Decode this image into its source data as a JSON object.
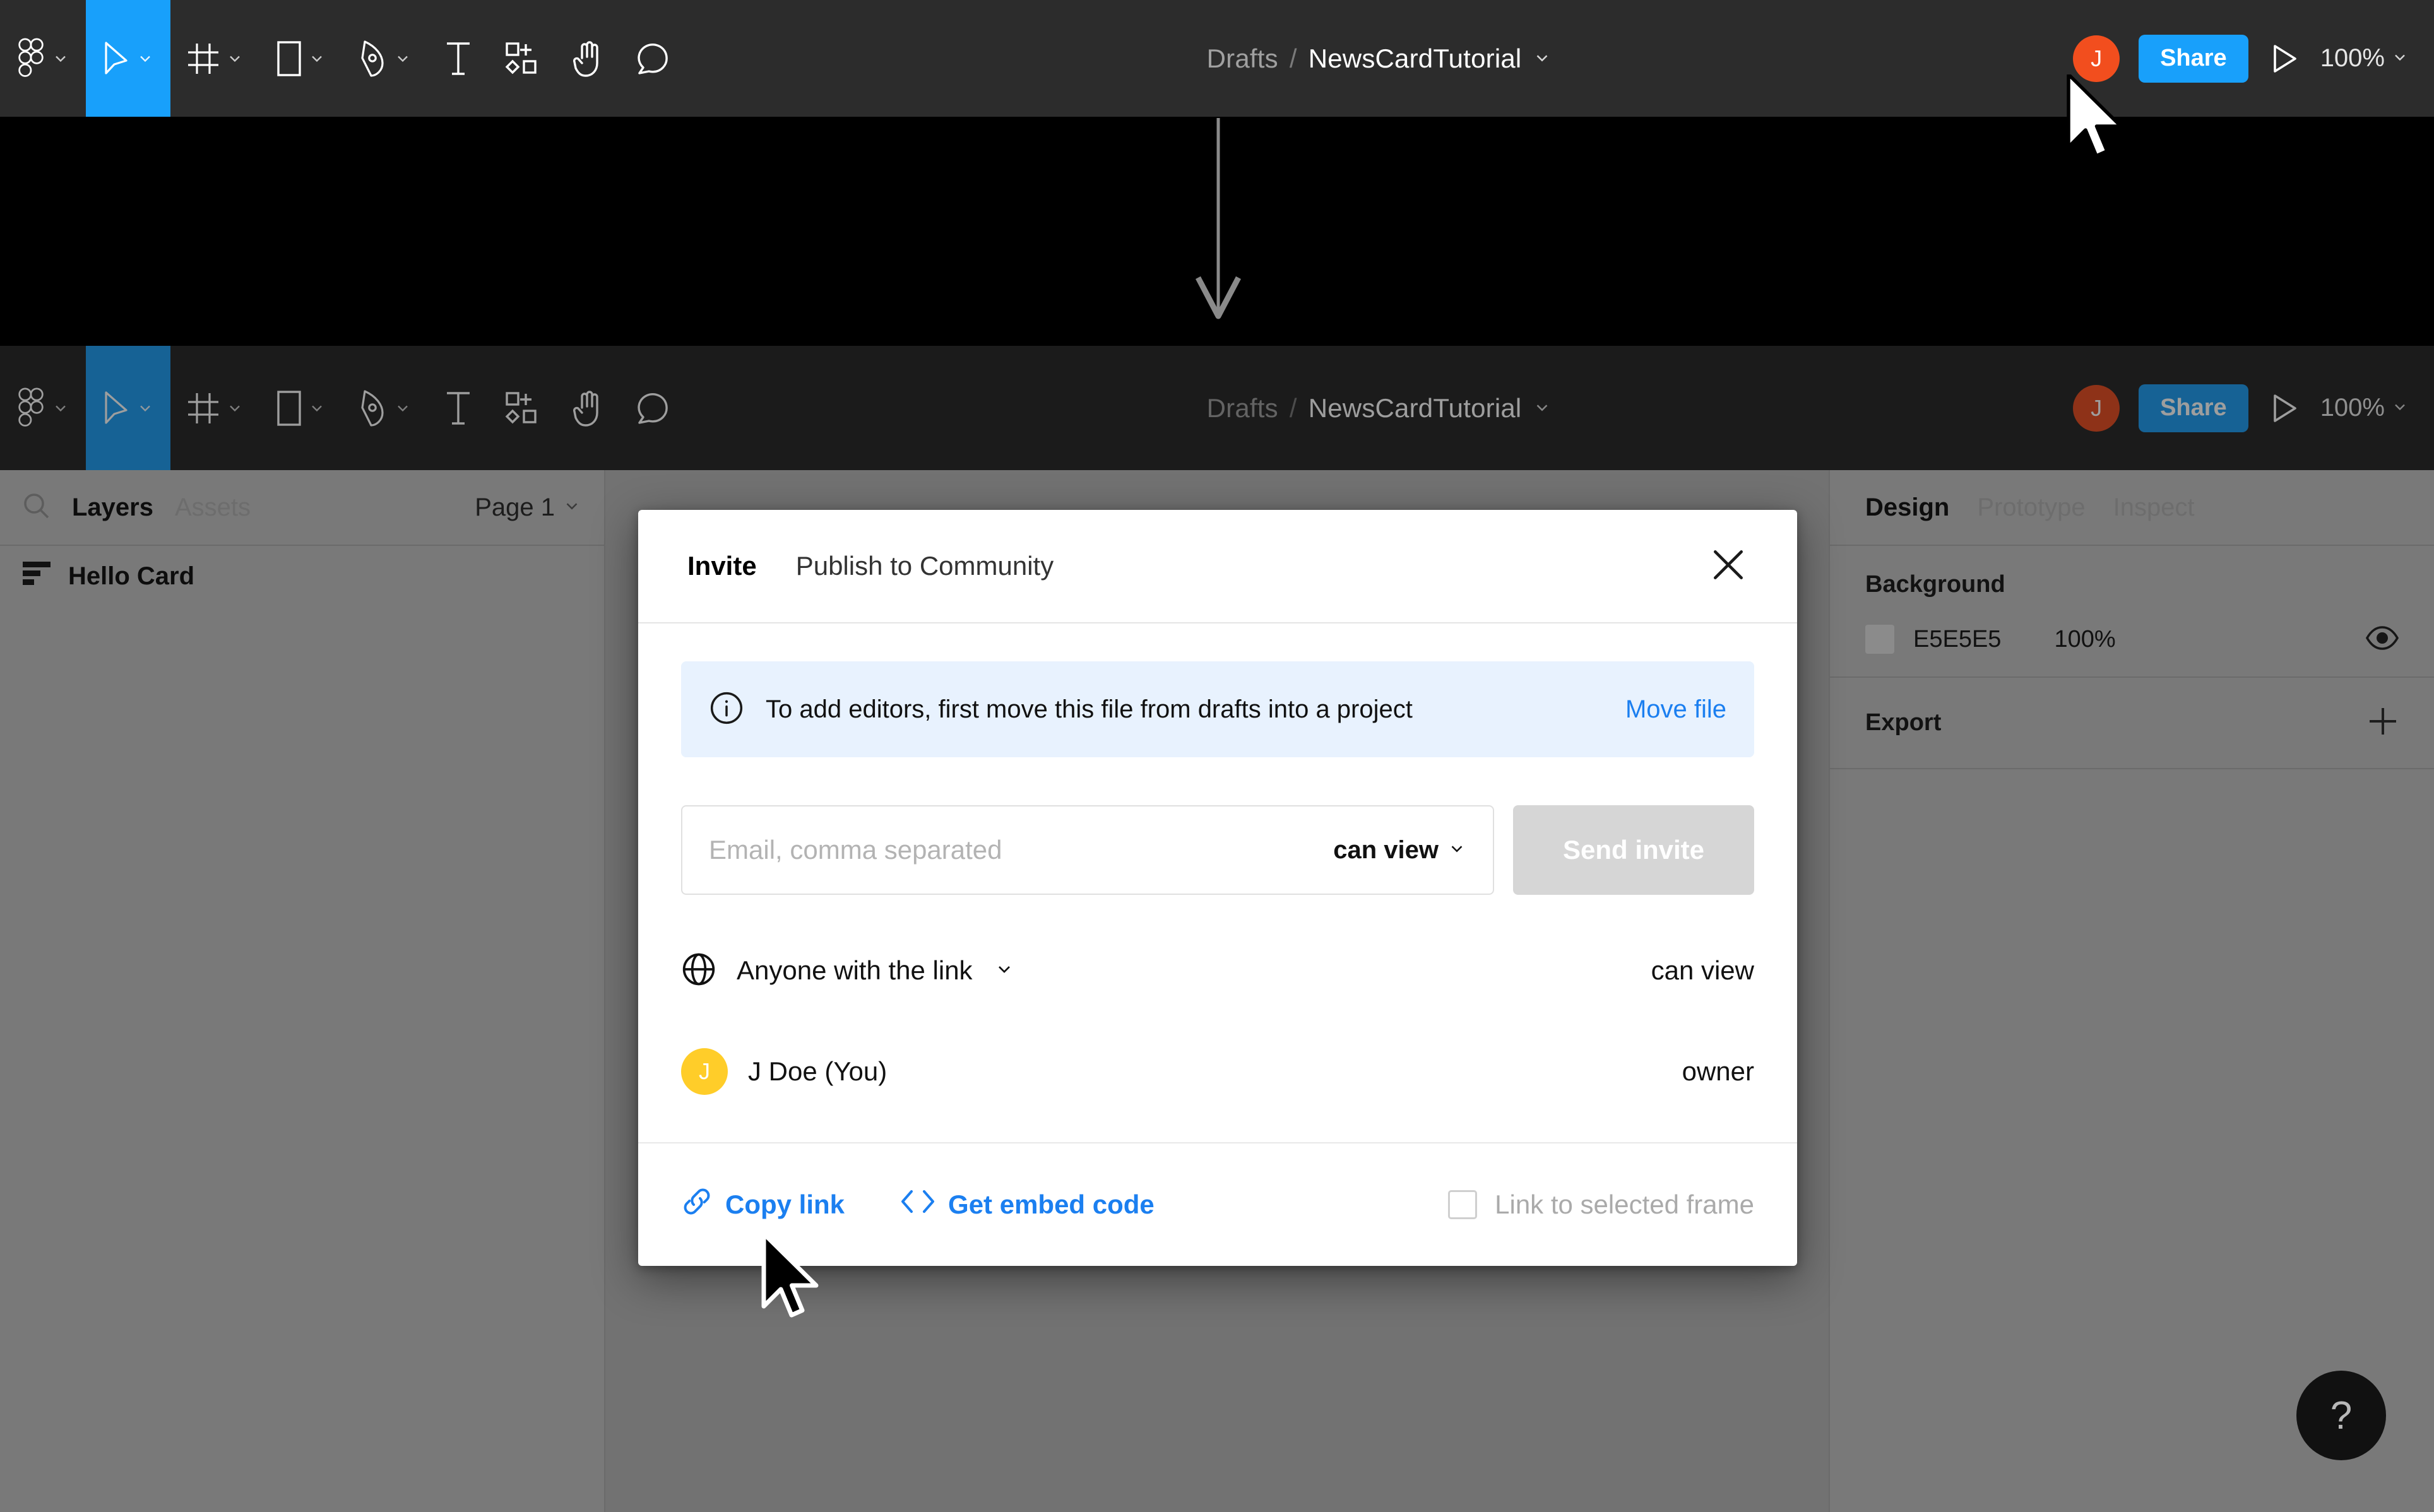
{
  "toolbar": {
    "tools": [
      {
        "name": "figma-logo-icon",
        "caret": true
      },
      {
        "name": "move-tool-icon",
        "caret": true,
        "active": true
      },
      {
        "name": "frame-tool-icon",
        "caret": true
      },
      {
        "name": "shape-tool-icon",
        "caret": true
      },
      {
        "name": "pen-tool-icon",
        "caret": true
      },
      {
        "name": "text-tool-icon",
        "caret": false
      },
      {
        "name": "resources-tool-icon",
        "caret": false
      },
      {
        "name": "hand-tool-icon",
        "caret": false
      },
      {
        "name": "comment-tool-icon",
        "caret": false
      }
    ],
    "breadcrumb_project": "Drafts",
    "breadcrumb_separator": "/",
    "breadcrumb_file": "NewsCardTutorial",
    "avatar_initial": "J",
    "share_label": "Share",
    "zoom_level": "100%",
    "accent_color": "#18a0fb",
    "avatar_color": "#f24e1e"
  },
  "left_panel": {
    "tabs": [
      {
        "label": "Layers",
        "active": true
      },
      {
        "label": "Assets",
        "active": false
      }
    ],
    "page_selector": "Page 1",
    "layers": [
      {
        "label": "Hello Card"
      }
    ]
  },
  "right_panel": {
    "tabs": [
      {
        "label": "Design",
        "active": true
      },
      {
        "label": "Prototype",
        "active": false
      },
      {
        "label": "Inspect",
        "active": false
      }
    ],
    "background": {
      "title": "Background",
      "hex": "E5E5E5",
      "opacity": "100%"
    },
    "export": {
      "title": "Export"
    }
  },
  "help": {
    "label": "?"
  },
  "dialog": {
    "tabs": [
      {
        "label": "Invite",
        "active": true
      },
      {
        "label": "Publish to Community",
        "active": false
      }
    ],
    "close_label": "",
    "notice": {
      "text": "To add editors, first move this file from drafts into a project",
      "action": "Move file"
    },
    "invite": {
      "email_placeholder": "Email, comma separated",
      "permission": "can view",
      "send_label": "Send invite"
    },
    "access": [
      {
        "icon": "globe-icon",
        "label": "Anyone with the link",
        "has_chevron": true,
        "right": "can view"
      },
      {
        "icon": "avatar",
        "avatar_initial": "J",
        "label": "J Doe (You)",
        "has_chevron": false,
        "right": "owner"
      }
    ],
    "footer": {
      "copy_link": "Copy link",
      "embed_code": "Get embed code",
      "checkbox_label": "Link to selected frame"
    },
    "link_color": "#1b7ff0"
  }
}
